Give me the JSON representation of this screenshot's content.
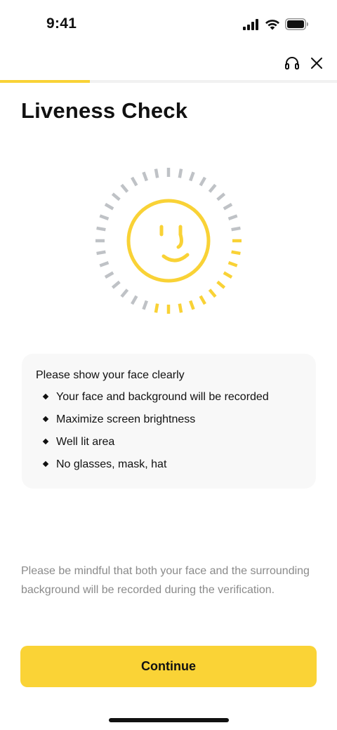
{
  "status_bar": {
    "time": "9:41",
    "icons": [
      "cellular-signal-icon",
      "wifi-icon",
      "battery-icon"
    ]
  },
  "header": {
    "support_icon": "headset-icon",
    "close_icon": "close-icon"
  },
  "progress": {
    "value": 0.267,
    "color": "#f9d236"
  },
  "page_title": "Liveness Check",
  "face_graphic": {
    "icon": "smiley-face-icon",
    "active_color": "#f9d236",
    "inactive_color": "#bfc2c6",
    "tick_count": 36,
    "completed_ticks": 11
  },
  "instructions": {
    "title": "Please show your face clearly",
    "items": [
      "Your face and background will be recorded",
      "Maximize screen brightness",
      "Well lit area",
      "No glasses, mask, hat"
    ]
  },
  "disclaimer": "Please be mindful that both your face and the surrounding background will be recorded during the verification.",
  "continue_button": {
    "label": "Continue",
    "color": "#fad336"
  }
}
